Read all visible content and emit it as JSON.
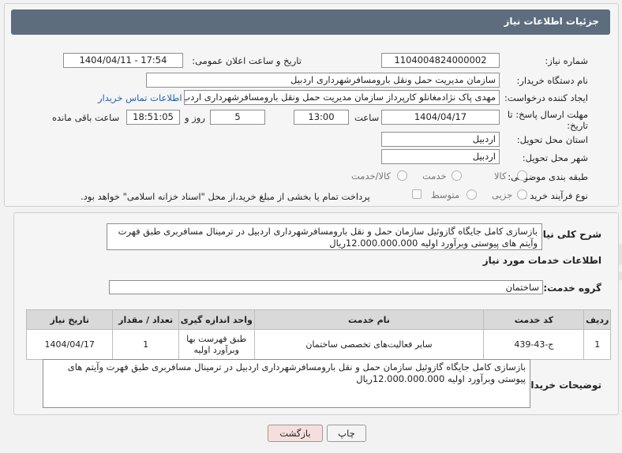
{
  "header": {
    "title": "جزئیات اطلاعات نیاز"
  },
  "fields": {
    "need_number": {
      "label": "شماره نیاز:",
      "value": "1104004824000002"
    },
    "announce_datetime": {
      "label": "تاریخ و ساعت اعلان عمومی:",
      "value": "1404/04/11 - 17:54"
    },
    "buyer_org": {
      "label": "نام دستگاه خریدار:",
      "value": "سازمان مدیریت حمل ونقل بارومسافرشهرداری اردبیل"
    },
    "requester": {
      "label": "ایجاد کننده درخواست:",
      "value": "مهدی پاک نژادمغانلو کارپرداز سازمان مدیریت حمل ونقل بارومسافرشهرداری اردب",
      "contact_link": "اطلاعات تماس خریدار"
    },
    "deadline": {
      "label_line1": "مهلت ارسال پاسخ: تا",
      "label_line2": "تاریخ:",
      "date": "1404/04/17",
      "time_label": "ساعت",
      "time": "13:00",
      "days": "5",
      "days_label": "روز و",
      "remaining": "18:51:05",
      "remaining_label": "ساعت باقی مانده"
    },
    "province": {
      "label": "استان محل تحویل:",
      "value": "اردبیل"
    },
    "city": {
      "label": "شهر محل تحویل:",
      "value": "اردبیل"
    },
    "category": {
      "label": "طبقه بندی موضوعی:",
      "options": [
        "کالا",
        "خدمت",
        "کالا/خدمت"
      ]
    },
    "process_type": {
      "label": "نوع فرآیند خرید :",
      "options": [
        "جزیی",
        "متوسط"
      ],
      "payment_note": "پرداخت تمام یا بخشی از مبلغ خرید،از محل \"اسناد خزانه اسلامی\" خواهد بود."
    }
  },
  "summary": {
    "label": "شرح کلی نیاز:",
    "text": "بازسازی کامل جایگاه گازوئیل سازمان حمل و نقل بارومسافرشهرداری اردبیل در ترمینال مسافربری طبق فهرت وآیتم های پیوستی وبرآورد اولیه 12.000.000.000ریال"
  },
  "services": {
    "section_title": "اطلاعات خدمات مورد نیاز",
    "group_label": "گروه خدمت:",
    "group_value": "ساختمان",
    "columns": [
      "ردیف",
      "کد خدمت",
      "نام خدمت",
      "واحد اندازه گیری",
      "تعداد / مقدار",
      "تاریخ نیاز"
    ],
    "rows": [
      {
        "row": "1",
        "code": "ج-43-439",
        "name": "سایر فعالیت‌های تخصصی ساختمان",
        "unit": "طبق فهرست بها وبرآورد اولیه",
        "qty": "1",
        "date": "1404/04/17"
      }
    ]
  },
  "buyer_notes": {
    "label": "توضیحات خریدار:",
    "text": "بازسازی کامل جایگاه گازوئیل سازمان حمل و نقل بارومسافرشهرداری اردبیل در ترمینال مسافربری طبق فهرت وآیتم های پیوستی وبرآورد اولیه 12.000.000.000ریال"
  },
  "buttons": {
    "print": "چاپ",
    "back": "بازگشت"
  },
  "watermark": {
    "text": "AriaTender.neT"
  },
  "colors": {
    "header": "#5d6d7e",
    "link": "#1e63b3",
    "back_button": "#f7dede"
  }
}
